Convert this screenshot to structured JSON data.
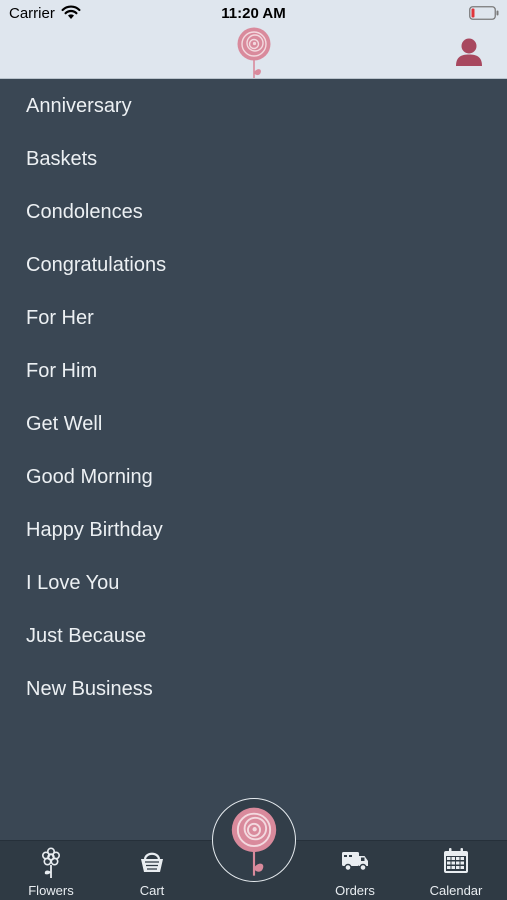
{
  "status_bar": {
    "carrier": "Carrier",
    "time": "11:20 AM"
  },
  "header": {
    "logo_icon": "rose-logo-icon",
    "profile_icon": "user-profile-icon"
  },
  "categories": [
    "Anniversary",
    "Baskets",
    "Condolences",
    "Congratulations",
    "For Her",
    "For Him",
    "Get Well",
    "Good Morning",
    "Happy Birthday",
    "I Love You",
    "Just Because",
    "New Business"
  ],
  "tab_bar": {
    "tabs": [
      {
        "label": "Flowers",
        "icon": "flower-icon"
      },
      {
        "label": "Cart",
        "icon": "basket-icon"
      },
      {
        "label": "Orders",
        "icon": "delivery-truck-icon"
      },
      {
        "label": "Calendar",
        "icon": "calendar-icon"
      }
    ],
    "center_icon": "rose-logo-icon"
  },
  "colors": {
    "header_bg": "#dfe6ee",
    "list_bg": "#3a4754",
    "tab_bar_bg": "#2f3a44",
    "accent_rose": "#d98a9c",
    "profile": "#a8485f"
  }
}
